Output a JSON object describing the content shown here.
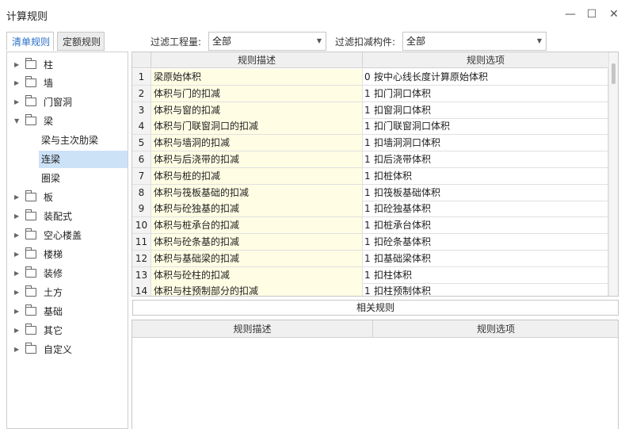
{
  "window": {
    "title": "计算规则",
    "minimize": "—",
    "maximize": "☐",
    "close": "✕"
  },
  "tabs": [
    "清单规则",
    "定额规则"
  ],
  "filters": {
    "project_label": "过滤工程量:",
    "project_value": "全部",
    "component_label": "过滤扣减构件:",
    "component_value": "全部"
  },
  "tree": {
    "items_before": [
      "柱",
      "墙",
      "门窗洞"
    ],
    "expanded": "梁",
    "children": [
      "梁与主次肋梁",
      "连梁",
      "圈梁"
    ],
    "selected_child": "连梁",
    "items_after": [
      "板",
      "装配式",
      "空心楼盖",
      "楼梯",
      "装修",
      "土方",
      "基础",
      "其它",
      "自定义"
    ]
  },
  "rules_table": {
    "headers": [
      "规则描述",
      "规则选项"
    ],
    "rows": [
      {
        "n": "1",
        "desc": "梁原始体积",
        "code": "0",
        "opt": "按中心线长度计算原始体积"
      },
      {
        "n": "2",
        "desc": "体积与门的扣减",
        "code": "1",
        "opt": "扣门洞口体积"
      },
      {
        "n": "3",
        "desc": "体积与窗的扣减",
        "code": "1",
        "opt": "扣窗洞口体积"
      },
      {
        "n": "4",
        "desc": "体积与门联窗洞口的扣减",
        "code": "1",
        "opt": "扣门联窗洞口体积"
      },
      {
        "n": "5",
        "desc": "体积与墙洞的扣减",
        "code": "1",
        "opt": "扣墙洞洞口体积"
      },
      {
        "n": "6",
        "desc": "体积与后浇带的扣减",
        "code": "1",
        "opt": "扣后浇带体积"
      },
      {
        "n": "7",
        "desc": "体积与桩的扣减",
        "code": "1",
        "opt": "扣桩体积"
      },
      {
        "n": "8",
        "desc": "体积与筏板基础的扣减",
        "code": "1",
        "opt": "扣筏板基础体积"
      },
      {
        "n": "9",
        "desc": "体积与砼独基的扣减",
        "code": "1",
        "opt": "扣砼独基体积"
      },
      {
        "n": "10",
        "desc": "体积与桩承台的扣减",
        "code": "1",
        "opt": "扣桩承台体积"
      },
      {
        "n": "11",
        "desc": "体积与砼条基的扣减",
        "code": "1",
        "opt": "扣砼条基体积"
      },
      {
        "n": "12",
        "desc": "体积与基础梁的扣减",
        "code": "1",
        "opt": "扣基础梁体积"
      },
      {
        "n": "13",
        "desc": "体积与砼柱的扣减",
        "code": "1",
        "opt": "扣柱体积"
      },
      {
        "n": "14",
        "desc": "体积与柱预制部分的扣减",
        "code": "1",
        "opt": "扣柱预制体积"
      }
    ]
  },
  "related": {
    "title": "相关规则",
    "headers": [
      "规则描述",
      "规则选项"
    ]
  }
}
